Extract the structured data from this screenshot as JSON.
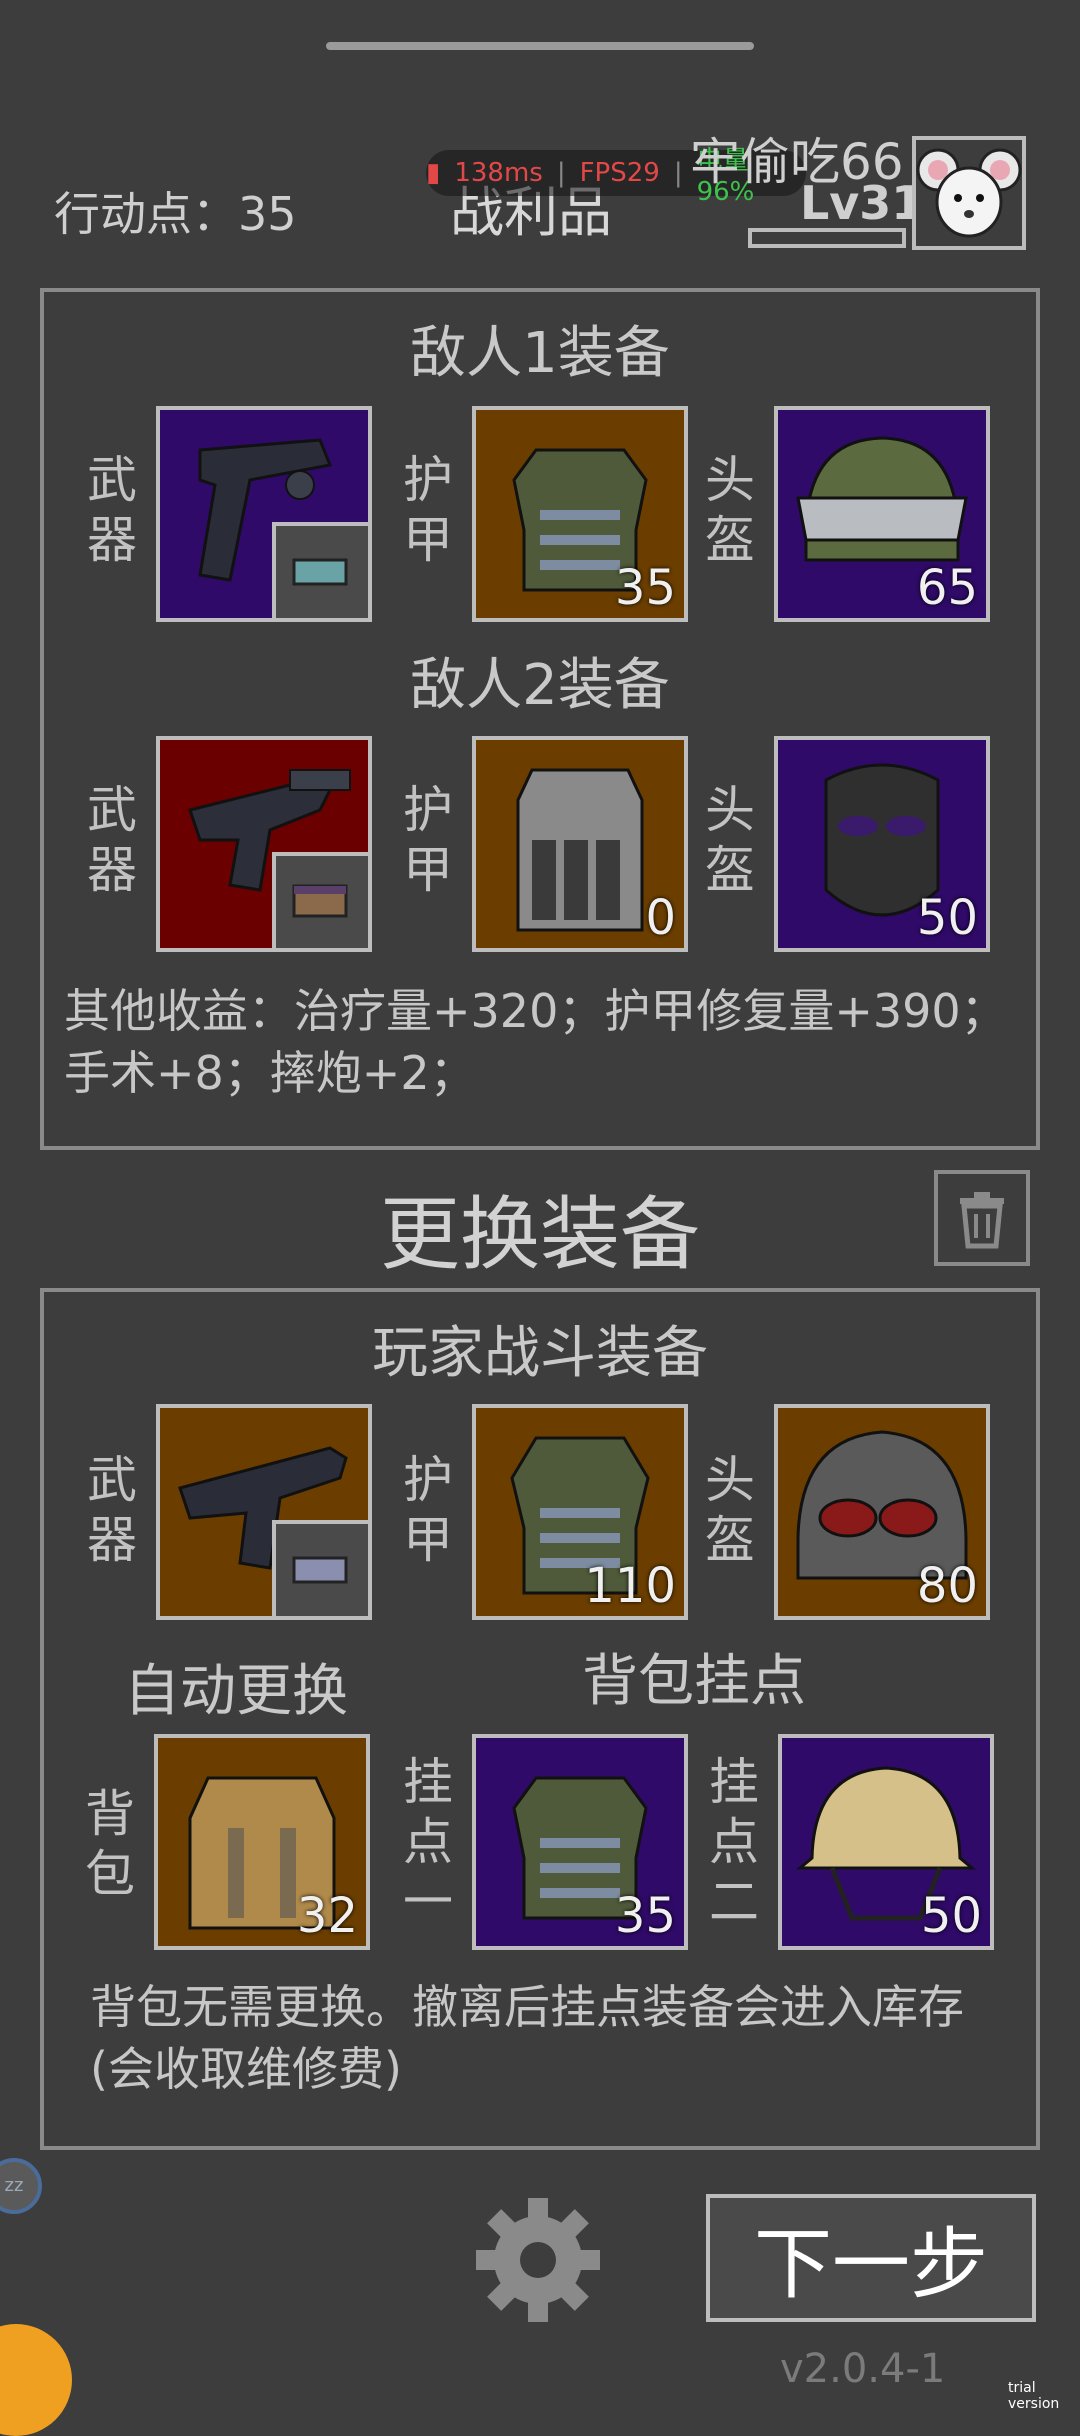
{
  "header": {
    "action_points": "行动点：35",
    "loot_title": "战利品",
    "perf": {
      "ping": "138ms",
      "fps": "FPS29",
      "battery": "电量96%",
      "separator": "|"
    },
    "player_name": "牢偷吃66",
    "player_level": "Lv31"
  },
  "enemy1": {
    "title": "敌人1装备",
    "weapon_label": "武器",
    "armor_label": "护甲",
    "helmet_label": "头盔",
    "armor_value": "35",
    "helmet_value": "65"
  },
  "enemy2": {
    "title": "敌人2装备",
    "weapon_label": "武器",
    "armor_label": "护甲",
    "helmet_label": "头盔",
    "armor_value": "0",
    "helmet_value": "50"
  },
  "other_gains": "其他收益：治疗量+320；护甲修复量+390；手术+8；摔炮+2；",
  "change_title": "更换装备",
  "player": {
    "title": "玩家战斗装备",
    "weapon_label": "武器",
    "armor_label": "护甲",
    "helmet_label": "头盔",
    "armor_value": "110",
    "helmet_value": "80",
    "auto_replace": "自动更换",
    "backpack_mounts": "背包挂点",
    "backpack_label": "背包",
    "mount1_label": "挂点一",
    "mount2_label": "挂点二",
    "backpack_value": "32",
    "mount1_value": "35",
    "mount2_value": "50",
    "note": "背包无需更换。撤离后挂点装备会进入库存(会收取维修费)"
  },
  "footer": {
    "next_button": "下一步",
    "version": "v2.0.4-1",
    "trial": "trial version",
    "side_bubble": "zz"
  },
  "colors": {
    "background": "#3d3d3d",
    "rarity_purple": "#2f0a68",
    "rarity_brown": "#6b3e00",
    "rarity_red": "#6a0000"
  }
}
